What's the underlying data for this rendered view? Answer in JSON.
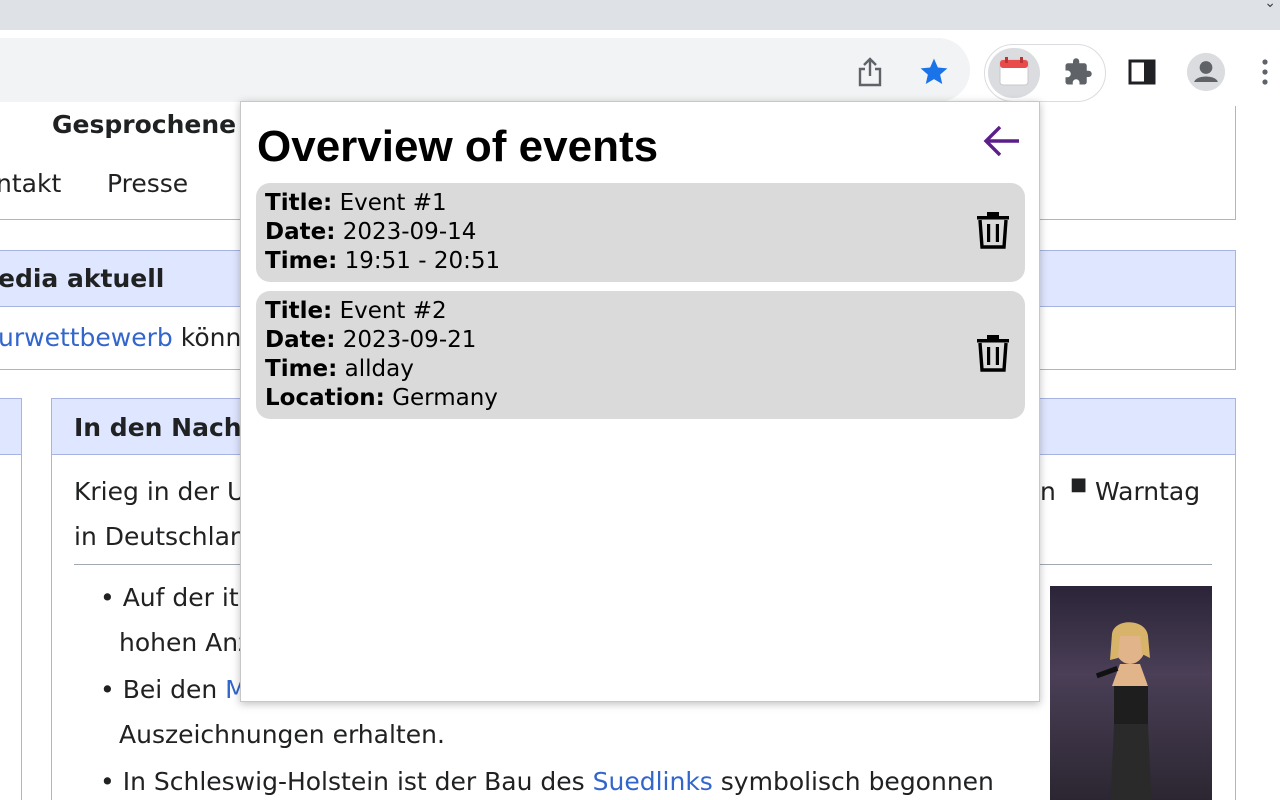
{
  "icons": {
    "share": "share-icon",
    "bookmark": "star-icon",
    "extension_calendar": "calendar-icon",
    "extensions": "puzzle-icon",
    "side_panel": "side-panel-icon",
    "profile": "profile-icon",
    "menu": "more-vert-icon",
    "back": "arrow-left-icon",
    "delete": "trash-icon"
  },
  "colors": {
    "accent_star": "#1a73e8",
    "back_arrow": "#5b1f8a",
    "card_bg": "#dadada",
    "wiki_link": "#3366cc"
  },
  "wiki": {
    "top_link_bold": "Gesprochene",
    "nav_kontakt": "ntakt",
    "nav_presse": "Presse",
    "section_aktuell": "edia aktuell",
    "aktuell_link": "urwettbewerb",
    "aktuell_text": " könne",
    "nachrichten_header": "In den Nachr",
    "news_link_1": "Krieg in der U",
    "news_link_1_end": "n",
    "news_link_warntag": "Warntag",
    "news_link_2": "in Deutschlan",
    "bullet_1_a": "Auf der ita",
    "bullet_1_b": "hohen Anz",
    "bullet_2_a": "Bei den ",
    "bullet_2_link": "M",
    "bullet_2_b": "Auszeichnungen erhalten.",
    "bullet_3_a": "In Schleswig-Holstein ist der Bau des ",
    "bullet_3_link": "Suedlinks",
    "bullet_3_b": " symbolisch begonnen"
  },
  "popup": {
    "title": "Overview of events",
    "labels": {
      "title": "Title:",
      "date": "Date:",
      "time": "Time:",
      "location": "Location:"
    },
    "events": [
      {
        "title": "Event #1",
        "date": "2023-09-14",
        "time": "19:51 - 20:51"
      },
      {
        "title": "Event #2",
        "date": "2023-09-21",
        "time": "allday",
        "location": "Germany"
      }
    ]
  }
}
